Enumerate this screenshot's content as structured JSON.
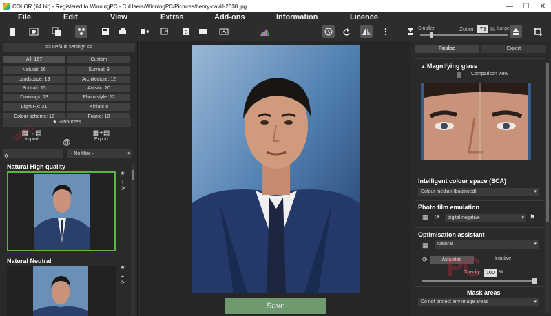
{
  "window": {
    "title": "COLOR (64 bit) - Registered to WinningPC - C:/Users/WinningPC/Pictures/henry-cavill-2338.jpg",
    "minimize": "—",
    "maximize": "☐",
    "close": "✕"
  },
  "menu": [
    "File",
    "Edit",
    "View",
    "Extras",
    "Add-ons",
    "Information",
    "Licence"
  ],
  "toolbar": {
    "zoom_label": "Zoom",
    "zoom_value": "73",
    "zoom_pct": "%",
    "smaller": "Smaller",
    "larger": "Larger",
    "zoom_level_fraction": 0.11
  },
  "left": {
    "default_settings": ">> Default settings <<",
    "categories": [
      [
        "All: 167",
        "Custom"
      ],
      [
        "Natural: 16",
        "Surreal: 9"
      ],
      [
        "Landscape: 19",
        "Architecture: 12"
      ],
      [
        "Portrait: 15",
        "Artistic: 20"
      ],
      [
        "Drawings: 13",
        "Photo style: 12"
      ],
      [
        "Light FX: 21",
        "Kirlian: 8"
      ],
      [
        "Colour scheme: 12",
        "Frame: 10"
      ]
    ],
    "favourites": "Favourites",
    "import": "Import",
    "at": "@",
    "export": "Export",
    "filter": "- No filter -",
    "presets": [
      {
        "title": "Natural High quality",
        "selected": true
      },
      {
        "title": "Natural Neutral",
        "selected": false
      }
    ]
  },
  "center": {
    "save": "Save"
  },
  "right": {
    "tabs": [
      "Finalise",
      "Expert"
    ],
    "magnifying_glass": "Magnifying glass",
    "comparison_view": "Comparison view",
    "sca_title": "Intelligent colour space (SCA)",
    "sca_value": "Colour median (balanced)",
    "film_title": "Photo film emulation",
    "film_value": "digital negative",
    "assistant_title": "Optimisation assistant",
    "assistant_value": "Natural",
    "activated": "Activated",
    "inactive": "Inactive",
    "opacity_label": "Opacity",
    "opacity_value": "100",
    "opacity_pct": "%",
    "opacity_fraction": 1.0,
    "mask_title": "Mask areas",
    "mask_value": "Do not protect any image areas"
  },
  "colors": {
    "selection_green": "#5bb543",
    "save_button": "#6f9a6f"
  }
}
